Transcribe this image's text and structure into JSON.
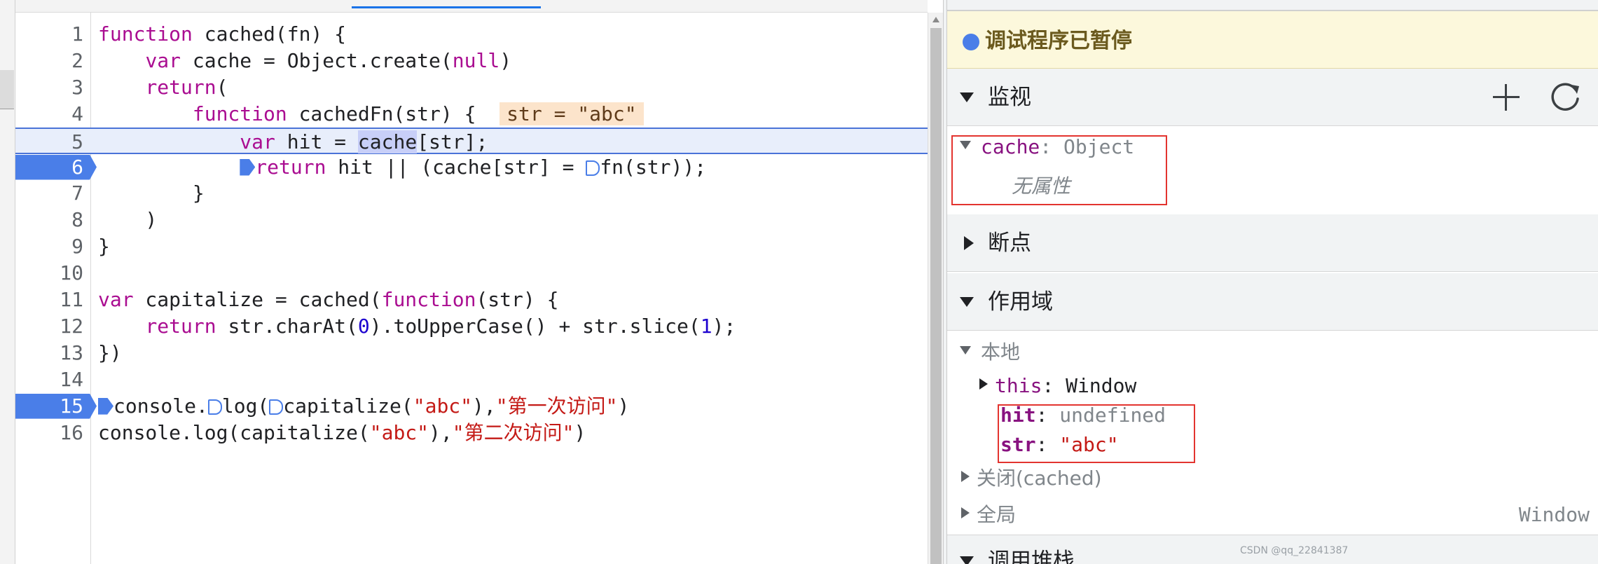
{
  "editor": {
    "lines": [
      {
        "n": "1",
        "tokens": [
          {
            "t": "function",
            "c": "kw"
          },
          {
            "t": " cached(fn) {",
            "c": ""
          }
        ]
      },
      {
        "n": "2",
        "tokens": [
          {
            "t": "    ",
            "c": ""
          },
          {
            "t": "var",
            "c": "kw"
          },
          {
            "t": " cache = Object.create(",
            "c": ""
          },
          {
            "t": "null",
            "c": "kw"
          },
          {
            "t": ")",
            "c": ""
          }
        ]
      },
      {
        "n": "3",
        "tokens": [
          {
            "t": "    ",
            "c": ""
          },
          {
            "t": "return",
            "c": "kw"
          },
          {
            "t": "(",
            "c": ""
          }
        ]
      },
      {
        "n": "4",
        "tokens": [
          {
            "t": "        ",
            "c": ""
          },
          {
            "t": "function",
            "c": "kw"
          },
          {
            "t": " cachedFn(str) {  ",
            "c": ""
          },
          {
            "t": "str = \"abc\"",
            "c": "inline-value"
          }
        ]
      },
      {
        "n": "5",
        "current": true,
        "tokens": [
          {
            "t": "            ",
            "c": ""
          },
          {
            "t": "var",
            "c": "kw"
          },
          {
            "t": " hit = ",
            "c": ""
          },
          {
            "t": "cache",
            "c": "sel"
          },
          {
            "t": "[str];",
            "c": ""
          }
        ]
      },
      {
        "n": "6",
        "bp": true,
        "tokens": [
          {
            "t": "            ",
            "c": ""
          },
          {
            "t": "",
            "c": "pause-mark"
          },
          {
            "t": "return",
            "c": "kw"
          },
          {
            "t": " hit || (cache[str] = ",
            "c": ""
          },
          {
            "t": "",
            "c": "pause-mark hollow"
          },
          {
            "t": "fn(str));",
            "c": ""
          }
        ]
      },
      {
        "n": "7",
        "tokens": [
          {
            "t": "        }",
            "c": ""
          }
        ]
      },
      {
        "n": "8",
        "tokens": [
          {
            "t": "    )",
            "c": ""
          }
        ]
      },
      {
        "n": "9",
        "tokens": [
          {
            "t": "}",
            "c": ""
          }
        ]
      },
      {
        "n": "10",
        "tokens": []
      },
      {
        "n": "11",
        "tokens": [
          {
            "t": "var",
            "c": "kw"
          },
          {
            "t": " capitalize = cached(",
            "c": ""
          },
          {
            "t": "function",
            "c": "kw"
          },
          {
            "t": "(str) {",
            "c": ""
          }
        ]
      },
      {
        "n": "12",
        "tokens": [
          {
            "t": "    ",
            "c": ""
          },
          {
            "t": "return",
            "c": "kw"
          },
          {
            "t": " str.charAt(",
            "c": ""
          },
          {
            "t": "0",
            "c": "num"
          },
          {
            "t": ").toUpperCase() + str.slice(",
            "c": ""
          },
          {
            "t": "1",
            "c": "num"
          },
          {
            "t": ");",
            "c": ""
          }
        ]
      },
      {
        "n": "13",
        "tokens": [
          {
            "t": "})",
            "c": ""
          }
        ]
      },
      {
        "n": "14",
        "tokens": []
      },
      {
        "n": "15",
        "bp": true,
        "tokens": [
          {
            "t": "",
            "c": "pause-mark"
          },
          {
            "t": "console.",
            "c": ""
          },
          {
            "t": "",
            "c": "pause-mark hollow"
          },
          {
            "t": "log(",
            "c": ""
          },
          {
            "t": "",
            "c": "pause-mark hollow"
          },
          {
            "t": "capitalize(",
            "c": ""
          },
          {
            "t": "\"abc\"",
            "c": "str"
          },
          {
            "t": "),",
            "c": ""
          },
          {
            "t": "\"第一次访问\"",
            "c": "str"
          },
          {
            "t": ")",
            "c": ""
          }
        ]
      },
      {
        "n": "16",
        "tokens": [
          {
            "t": "console.log(capitalize(",
            "c": ""
          },
          {
            "t": "\"abc\"",
            "c": "str"
          },
          {
            "t": "),",
            "c": ""
          },
          {
            "t": "\"第二次访问\"",
            "c": "str"
          },
          {
            "t": ")",
            "c": ""
          }
        ]
      }
    ]
  },
  "debugger": {
    "paused_text": "调试程序已暂停",
    "watch": {
      "title": "监视",
      "add_icon": "plus-icon",
      "refresh_icon": "refresh-icon",
      "item_name": "cache",
      "item_sep": ": ",
      "item_value": "Object",
      "no_props": "无属性"
    },
    "breakpoints": {
      "title": "断点"
    },
    "scope": {
      "title": "作用域",
      "local_label": "本地",
      "this_name": "this",
      "this_value": "Window",
      "hit_name": "hit",
      "hit_value": "undefined",
      "str_name": "str",
      "str_value": "\"abc\"",
      "closure_label": "关闭(cached)",
      "global_label": "全局",
      "global_value": "Window"
    },
    "call_stack": {
      "title": "调用堆栈"
    },
    "colon": ": "
  },
  "watermark": "CSDN @qq_22841387",
  "colors": {
    "accent": "#4a7ee8",
    "highlight_box": "#e3342f",
    "banner_bg": "#fcf8dc"
  }
}
